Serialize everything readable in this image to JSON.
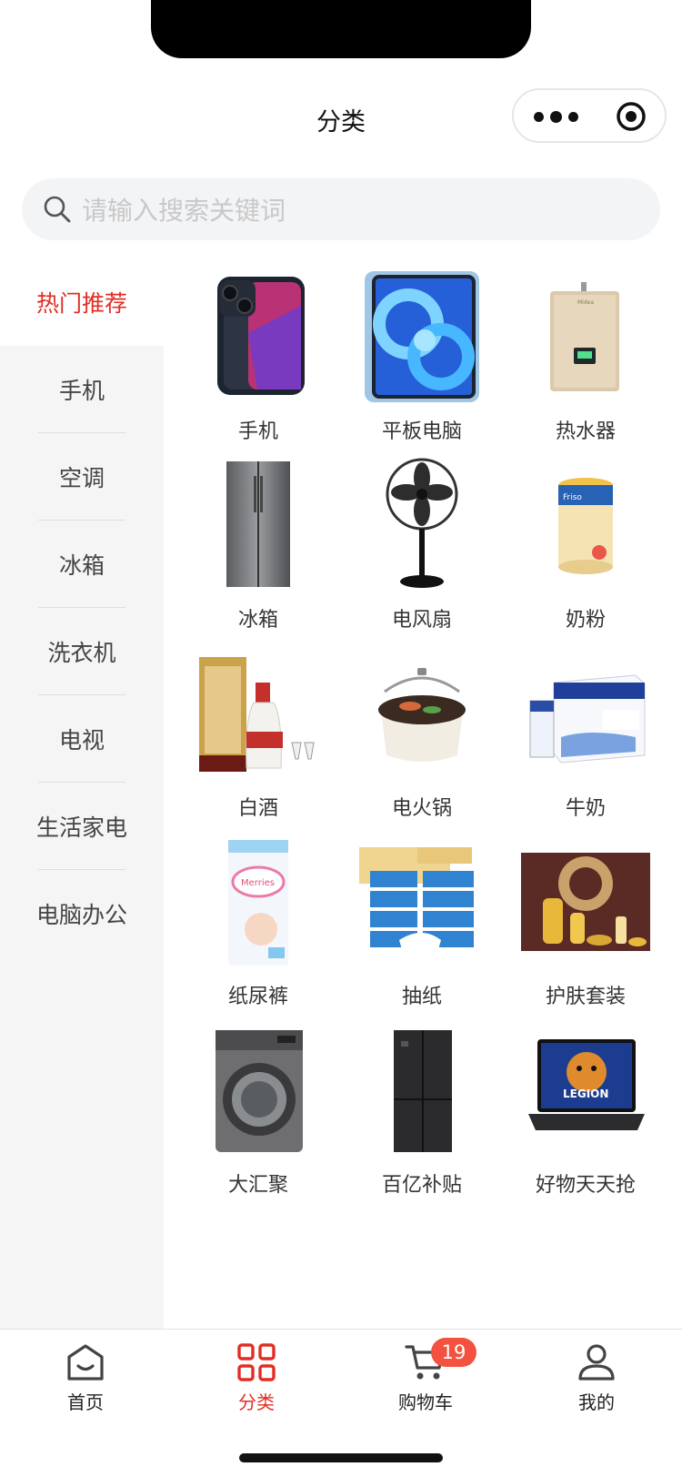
{
  "header": {
    "title": "分类"
  },
  "search": {
    "placeholder": "请输入搜索关键词"
  },
  "sidebar": {
    "items": [
      {
        "label": "热门推荐",
        "active": true
      },
      {
        "label": "手机"
      },
      {
        "label": "空调"
      },
      {
        "label": "冰箱"
      },
      {
        "label": "洗衣机"
      },
      {
        "label": "电视"
      },
      {
        "label": "生活家电"
      },
      {
        "label": "电脑办公"
      }
    ]
  },
  "grid": {
    "items": [
      {
        "label": "手机",
        "icon": "phone-image"
      },
      {
        "label": "平板电脑",
        "icon": "tablet-image"
      },
      {
        "label": "热水器",
        "icon": "water-heater-image"
      },
      {
        "label": "冰箱",
        "icon": "refrigerator-image"
      },
      {
        "label": "电风扇",
        "icon": "fan-image"
      },
      {
        "label": "奶粉",
        "icon": "milk-powder-image"
      },
      {
        "label": "白酒",
        "icon": "liquor-image"
      },
      {
        "label": "电火锅",
        "icon": "hotpot-image"
      },
      {
        "label": "牛奶",
        "icon": "milk-box-image"
      },
      {
        "label": "纸尿裤",
        "icon": "diaper-image"
      },
      {
        "label": "抽纸",
        "icon": "tissue-image"
      },
      {
        "label": "护肤套装",
        "icon": "skincare-image"
      },
      {
        "label": "大汇聚",
        "icon": "washing-machine-image"
      },
      {
        "label": "百亿补贴",
        "icon": "fridge-dark-image"
      },
      {
        "label": "好物天天抢",
        "icon": "laptop-image"
      }
    ]
  },
  "tabbar": {
    "items": [
      {
        "label": "首页",
        "icon": "home-icon"
      },
      {
        "label": "分类",
        "icon": "category-icon",
        "active": true
      },
      {
        "label": "购物车",
        "icon": "cart-icon",
        "badge": "19"
      },
      {
        "label": "我的",
        "icon": "user-icon"
      }
    ]
  },
  "colors": {
    "accent": "#e02e24",
    "badge": "#f2523f",
    "sidebar_bg": "#f5f5f5"
  }
}
